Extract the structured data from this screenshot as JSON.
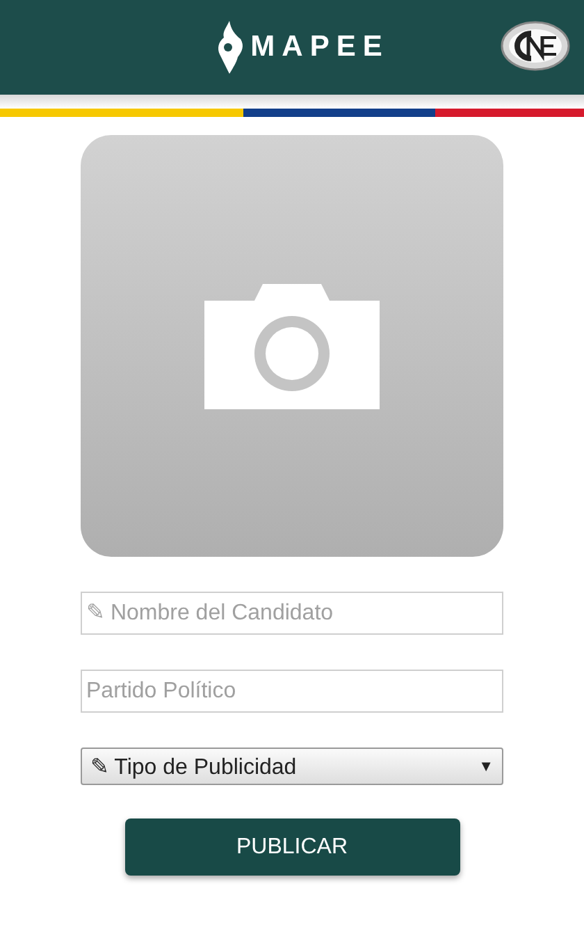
{
  "header": {
    "app_name": "MAPEE"
  },
  "form": {
    "fields": [
      {
        "placeholder": "✎ Nombre del Candidato"
      },
      {
        "placeholder": "Partido Político"
      }
    ],
    "select": {
      "value": "✎ Tipo de Publicidad",
      "caret": "▼"
    },
    "submit": "PUBLICAR"
  }
}
